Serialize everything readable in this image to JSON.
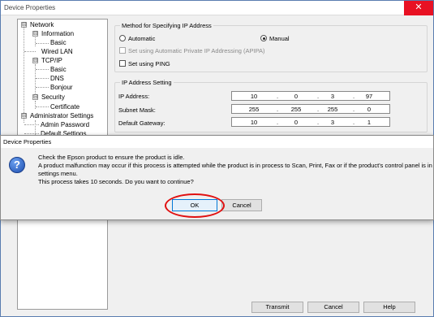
{
  "window": {
    "title": "Device Properties",
    "close_glyph": "✕"
  },
  "tree": {
    "items": [
      {
        "label": "Network"
      },
      {
        "label": "Information"
      },
      {
        "label": "Basic"
      },
      {
        "label": "Wired LAN"
      },
      {
        "label": "TCP/IP"
      },
      {
        "label": "Basic"
      },
      {
        "label": "DNS"
      },
      {
        "label": "Bonjour"
      },
      {
        "label": "Security"
      },
      {
        "label": "Certificate"
      },
      {
        "label": "Administrator Settings"
      },
      {
        "label": "Admin Password"
      },
      {
        "label": "Default Settings"
      }
    ],
    "expander": "⊟"
  },
  "method": {
    "title": "Method for Specifying IP Address",
    "automatic": "Automatic",
    "manual": "Manual",
    "apipa": "Set using Automatic Private IP Addressing (APIPA)",
    "ping": "Set using PING"
  },
  "ip_settings": {
    "title": "IP Address Setting",
    "rows": [
      {
        "label": "IP Address:",
        "octets": [
          "10",
          "0",
          "3",
          "97"
        ]
      },
      {
        "label": "Subnet Mask:",
        "octets": [
          "255",
          "255",
          "255",
          "0"
        ]
      },
      {
        "label": "Default Gateway:",
        "octets": [
          "10",
          "0",
          "3",
          "1"
        ]
      }
    ]
  },
  "footer": {
    "transmit": "Transmit",
    "cancel": "Cancel",
    "help": "Help"
  },
  "dialog": {
    "title": "Device Properties",
    "icon": "?",
    "lines": [
      "Check the Epson product to ensure the product is idle.",
      "A product malfunction may occur if this process is attempted while the product is in process to Scan, Print, Fax or if the product's control panel is in",
      "settings menu.",
      "This process takes 10 seconds. Do you want to continue?"
    ],
    "ok": "OK",
    "cancel": "Cancel"
  }
}
